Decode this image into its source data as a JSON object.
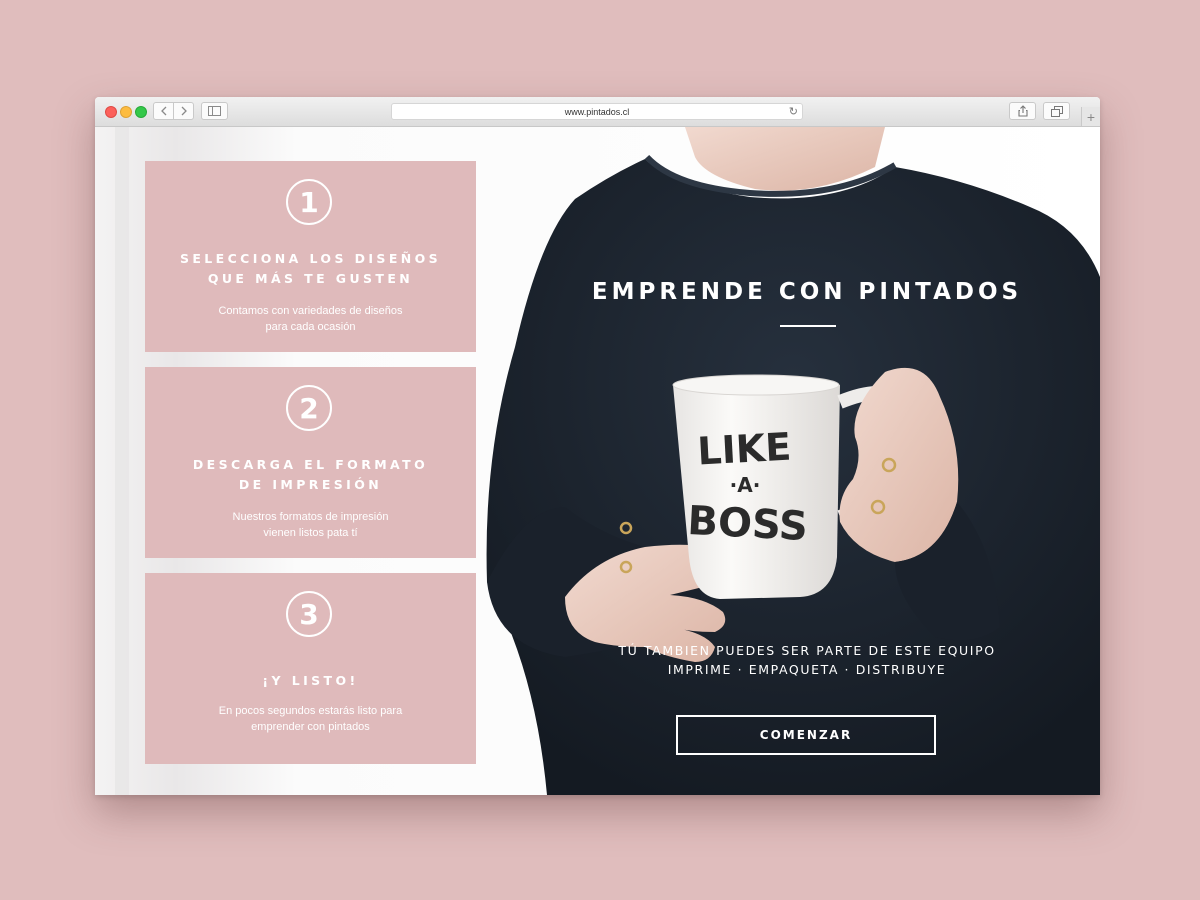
{
  "browser": {
    "url": "www.pintados.cl",
    "back_icon": "chevron-left-icon",
    "forward_icon": "chevron-right-icon",
    "sidebar_icon": "sidebar-icon",
    "reload_icon": "reload-icon",
    "share_icon": "share-icon",
    "tabs_icon": "tabs-icon",
    "newtab_icon": "plus-icon"
  },
  "steps": [
    {
      "number": "1",
      "title_line1": "SELECCIONA LOS DISEÑOS",
      "title_line2": "QUE MÁS TE GUSTEN",
      "desc_line1": "Contamos con variedades de diseños",
      "desc_line2": "para cada ocasión"
    },
    {
      "number": "2",
      "title_line1": "DESCARGA EL FORMATO",
      "title_line2": "DE IMPRESIÓN",
      "desc_line1": "Nuestros formatos de impresión",
      "desc_line2": "vienen listos pata tí"
    },
    {
      "number": "3",
      "title_line1": "¡Y LISTO!",
      "desc_line1": "En pocos segundos estarás listo para",
      "desc_line2": "emprender con pintados"
    }
  ],
  "hero": {
    "headline": "EMPRENDE CON PINTADOS",
    "subtitle_line1": "TÚ TAMBIEN PUEDES SER PARTE DE ESTE EQUIPO",
    "subtitle_line2": "IMPRIME · EMPAQUETA · DISTRIBUYE",
    "cta_label": "COMENZAR",
    "mug_text_line1": "LIKE",
    "mug_text_line2": "·A·",
    "mug_text_line3": "BOSS"
  },
  "colors": {
    "page_background": "#e0bdbd",
    "card_background": "#dfbabb",
    "sweater": "#1c2430"
  }
}
